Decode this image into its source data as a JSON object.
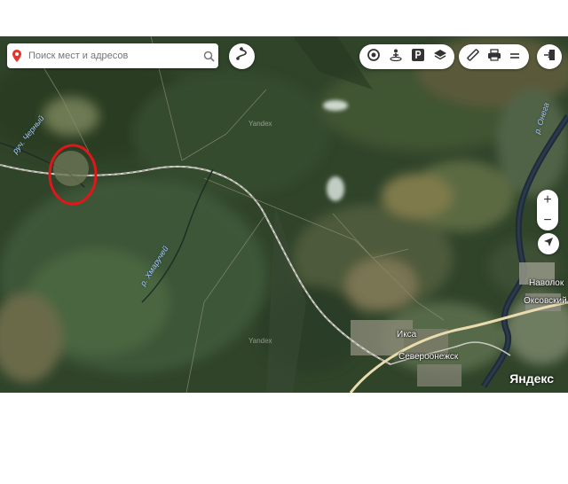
{
  "search": {
    "placeholder": "Поиск мест и адресов"
  },
  "map": {
    "labels": {
      "river_chernyi": "руч. Черный",
      "river_khmaruchei": "р. Хмаручей",
      "river_onega": "р. Онега",
      "town_navolok": "Наволок",
      "town_oksovskii": "Оксовский",
      "town_iksa": "Икса",
      "town_severoonezhsk": "Североонежск",
      "watermark_1": "Yandex",
      "watermark_2": "Yandex"
    },
    "brand": "Яндекс"
  },
  "controls": {
    "zoom_in": "+",
    "zoom_out": "−"
  },
  "icons": {
    "search_pin": "red-map-pin-icon",
    "search": "magnifier-icon",
    "route": "route-icon",
    "layers_group": [
      "traffic-icon",
      "panorama-icon",
      "parking-icon",
      "layers-icon"
    ],
    "tools_group": [
      "ruler-icon",
      "print-icon",
      "menu-icon"
    ],
    "login": "login-icon",
    "location": "geolocation-arrow-icon"
  },
  "colors": {
    "pin_red": "#e5352b",
    "annotation_circle": "#e0161b"
  }
}
